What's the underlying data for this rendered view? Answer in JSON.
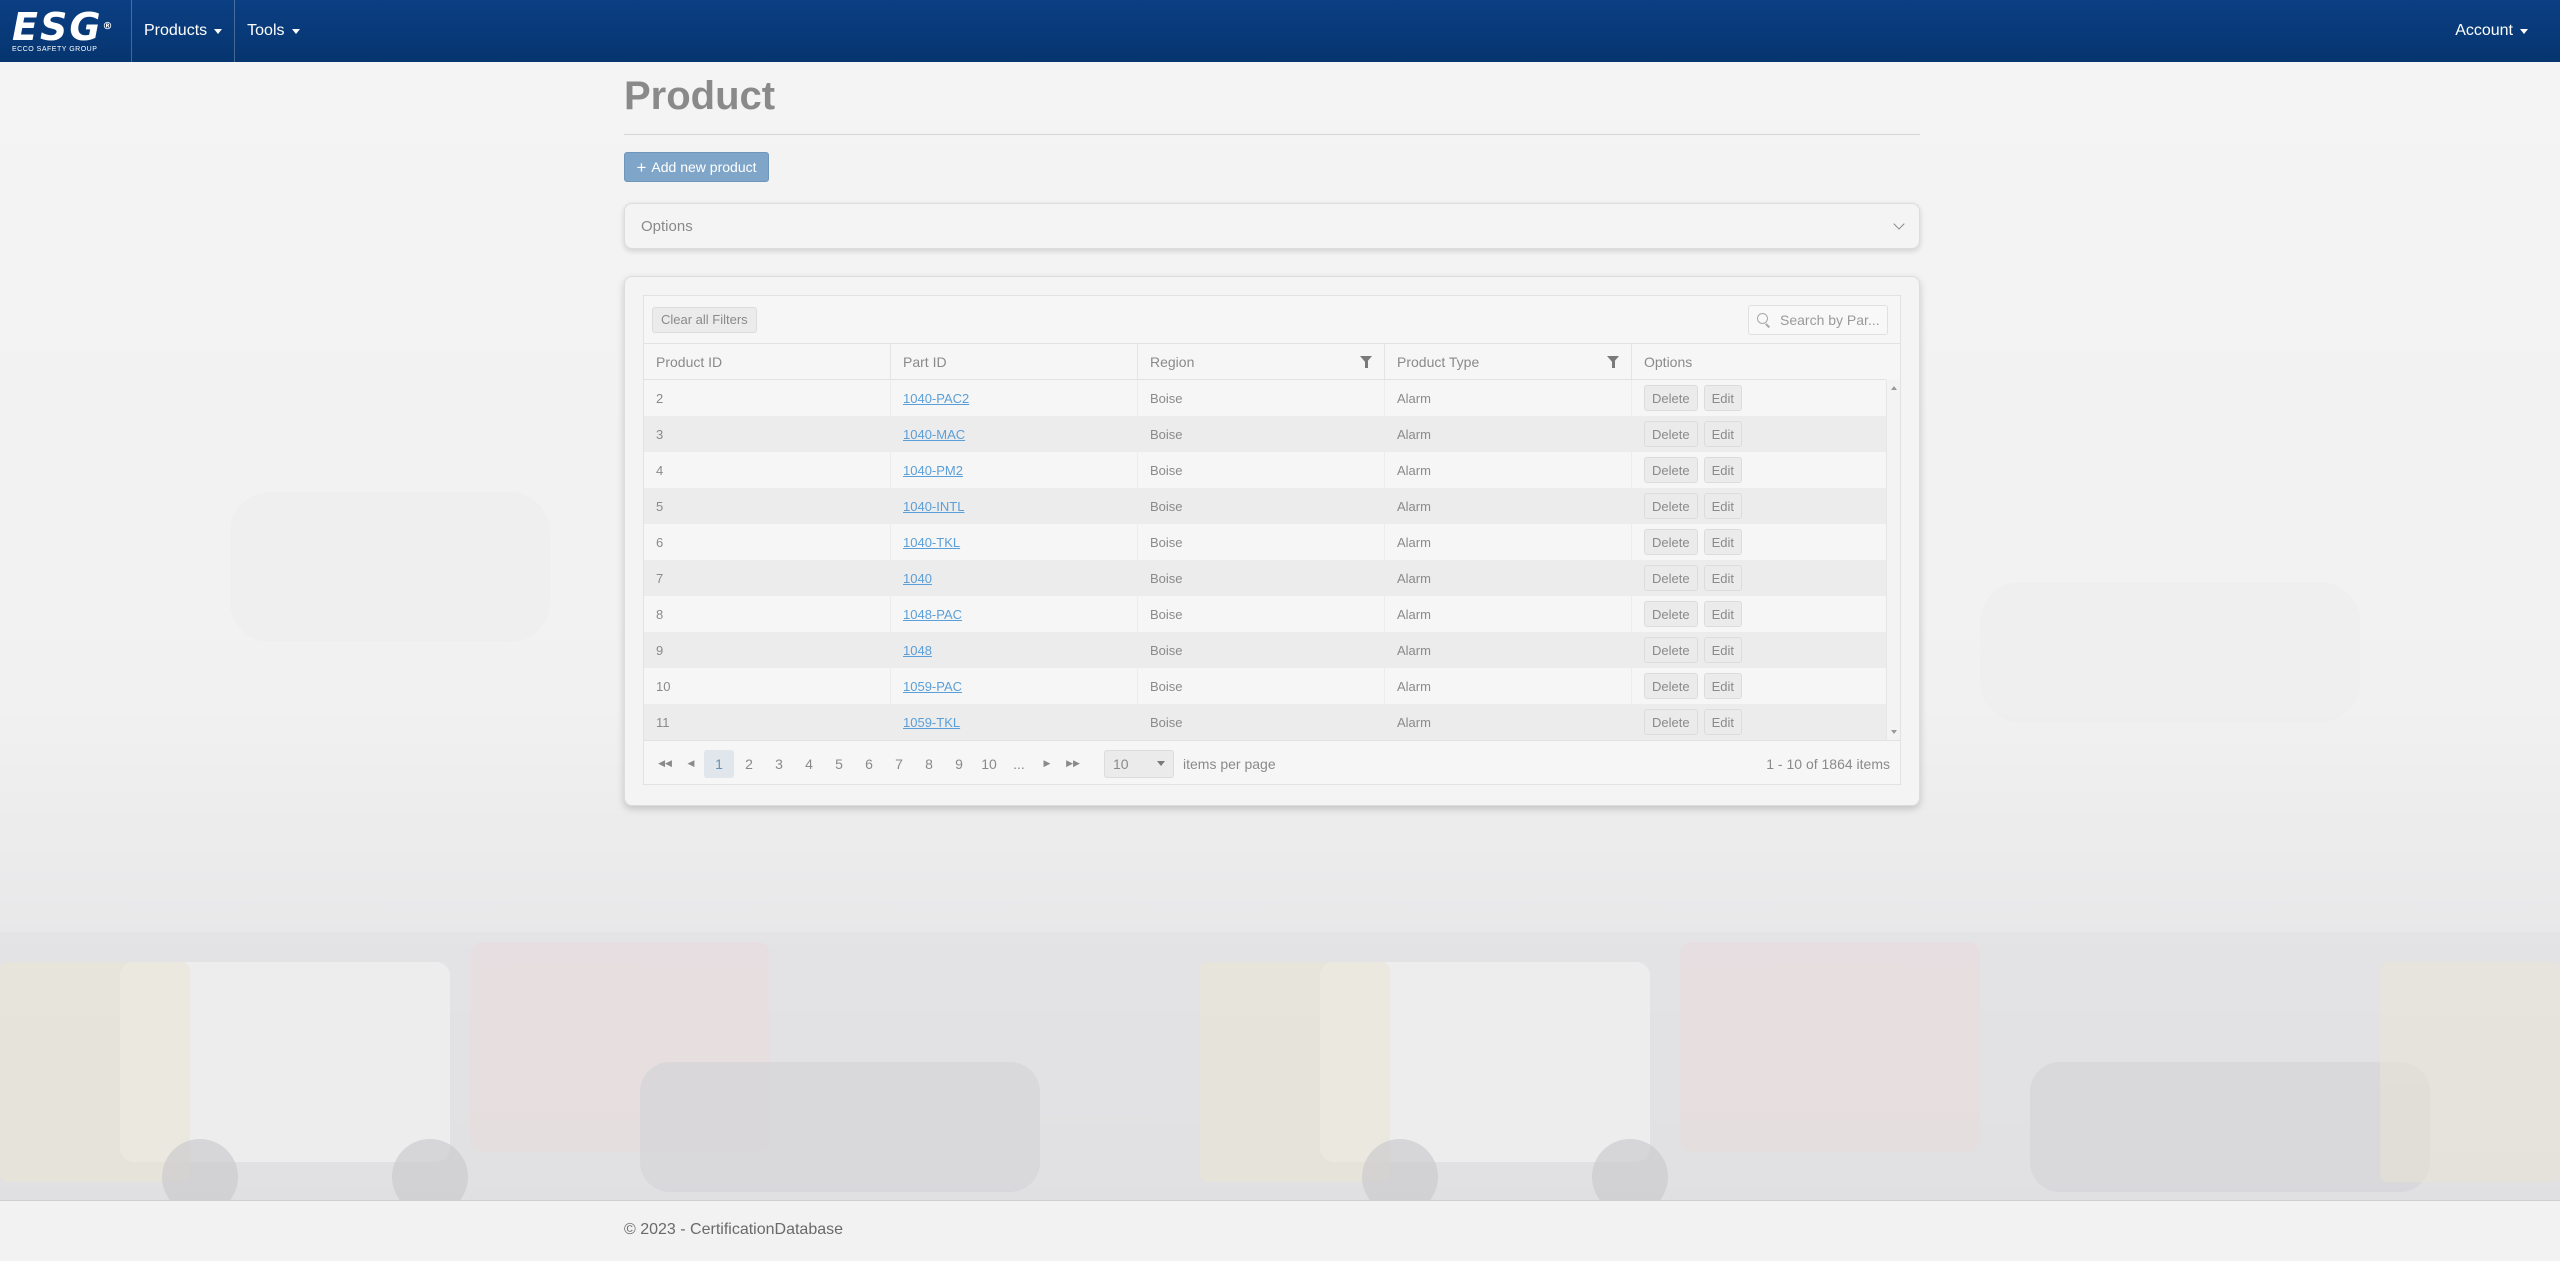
{
  "nav": {
    "brand_logo": "ESG",
    "brand_mark": "®",
    "brand_sub": "ECCO SAFETY GROUP",
    "products_label": "Products",
    "tools_label": "Tools",
    "account_label": "Account"
  },
  "page": {
    "title": "Product",
    "add_button": "Add new product",
    "options_label": "Options"
  },
  "grid": {
    "clear_filters": "Clear all Filters",
    "search_placeholder": "Search by Par...",
    "columns": [
      "Product ID",
      "Part ID",
      "Region",
      "Product Type",
      "Options"
    ],
    "delete_label": "Delete",
    "edit_label": "Edit",
    "rows": [
      {
        "id": "2",
        "part": "1040-PAC2",
        "region": "Boise",
        "type": "Alarm"
      },
      {
        "id": "3",
        "part": "1040-MAC",
        "region": "Boise",
        "type": "Alarm"
      },
      {
        "id": "4",
        "part": "1040-PM2",
        "region": "Boise",
        "type": "Alarm"
      },
      {
        "id": "5",
        "part": "1040-INTL",
        "region": "Boise",
        "type": "Alarm"
      },
      {
        "id": "6",
        "part": "1040-TKL",
        "region": "Boise",
        "type": "Alarm"
      },
      {
        "id": "7",
        "part": "1040",
        "region": "Boise",
        "type": "Alarm"
      },
      {
        "id": "8",
        "part": "1048-PAC",
        "region": "Boise",
        "type": "Alarm"
      },
      {
        "id": "9",
        "part": "1048",
        "region": "Boise",
        "type": "Alarm"
      },
      {
        "id": "10",
        "part": "1059-PAC",
        "region": "Boise",
        "type": "Alarm"
      },
      {
        "id": "11",
        "part": "1059-TKL",
        "region": "Boise",
        "type": "Alarm"
      }
    ]
  },
  "pager": {
    "pages": [
      "1",
      "2",
      "3",
      "4",
      "5",
      "6",
      "7",
      "8",
      "9",
      "10",
      "..."
    ],
    "page_size": "10",
    "items_per_page": "items per page",
    "info": "1 - 10 of 1864 items"
  },
  "footer": {
    "text": "© 2023 - CertificationDatabase"
  },
  "colors": {
    "navbar": "#0b3f84",
    "accent_button": "#7fa6c9",
    "link": "#5b9fd8"
  }
}
